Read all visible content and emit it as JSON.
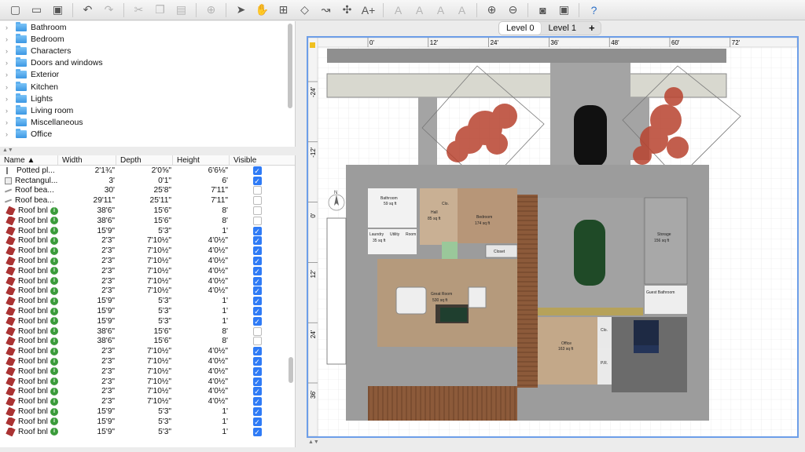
{
  "toolbar": {
    "buttons": [
      {
        "name": "new-home-button",
        "icon": "new-file-icon",
        "glyph": "▢"
      },
      {
        "name": "open-button",
        "icon": "folder-icon",
        "glyph": "▭"
      },
      {
        "name": "save-button",
        "icon": "save-icon",
        "glyph": "▣"
      },
      {
        "sep": true
      },
      {
        "name": "undo-button",
        "icon": "undo-icon",
        "glyph": "↶"
      },
      {
        "name": "redo-button",
        "icon": "redo-icon",
        "glyph": "↷",
        "dim": true
      },
      {
        "sep": true
      },
      {
        "name": "cut-button",
        "icon": "scissors-icon",
        "glyph": "✂",
        "dim": true
      },
      {
        "name": "copy-button",
        "icon": "copy-icon",
        "glyph": "❐",
        "dim": true
      },
      {
        "name": "paste-button",
        "icon": "paste-icon",
        "glyph": "▤",
        "dim": true
      },
      {
        "sep": true
      },
      {
        "name": "add-furniture-button",
        "icon": "add-furniture-icon",
        "glyph": "⊕",
        "dim": true
      },
      {
        "sep": true
      },
      {
        "name": "select-mode-button",
        "icon": "cursor-icon",
        "glyph": "➤"
      },
      {
        "name": "pan-mode-button",
        "icon": "hand-icon",
        "glyph": "✋"
      },
      {
        "name": "create-walls-button",
        "icon": "wall-icon",
        "glyph": "⊞"
      },
      {
        "name": "create-rooms-button",
        "icon": "room-icon",
        "glyph": "◇"
      },
      {
        "name": "create-polylines-button",
        "icon": "polyline-icon",
        "glyph": "↝"
      },
      {
        "name": "create-dimensions-button",
        "icon": "dimension-icon",
        "glyph": "✣"
      },
      {
        "name": "add-text-button",
        "icon": "text-icon",
        "glyph": "A+"
      },
      {
        "sep": true
      },
      {
        "name": "text-style-1-button",
        "icon": "text-style-icon",
        "glyph": "A",
        "dim": true
      },
      {
        "name": "text-style-2-button",
        "icon": "text-style-icon",
        "glyph": "A",
        "dim": true
      },
      {
        "name": "bold-button",
        "icon": "bold-icon",
        "glyph": "A",
        "dim": true
      },
      {
        "name": "italic-button",
        "icon": "italic-icon",
        "glyph": "A",
        "dim": true
      },
      {
        "sep": true
      },
      {
        "name": "zoom-in-button",
        "icon": "zoom-in-icon",
        "glyph": "⊕"
      },
      {
        "name": "zoom-out-button",
        "icon": "zoom-out-icon",
        "glyph": "⊖"
      },
      {
        "sep": true
      },
      {
        "name": "create-photo-button",
        "icon": "camera-icon",
        "glyph": "◙"
      },
      {
        "name": "create-video-button",
        "icon": "video-icon",
        "glyph": "▣"
      },
      {
        "sep": true
      },
      {
        "name": "help-button",
        "icon": "help-icon",
        "glyph": "?",
        "blue": true
      }
    ]
  },
  "catalog": {
    "categories": [
      "Bathroom",
      "Bedroom",
      "Characters",
      "Doors and windows",
      "Exterior",
      "Kitchen",
      "Lights",
      "Living room",
      "Miscellaneous",
      "Office"
    ]
  },
  "furniture_table": {
    "columns": {
      "name": "Name ▲",
      "width": "Width",
      "depth": "Depth",
      "height": "Height",
      "visible": "Visible"
    },
    "rows": [
      {
        "name": "Potted pl...",
        "w": "2'1¾\"",
        "d": "2'0⅝\"",
        "h": "6'6⅛\"",
        "v": true,
        "icon": "pot"
      },
      {
        "name": "Rectangul...",
        "w": "3'",
        "d": "0'1\"",
        "h": "6'",
        "v": true,
        "icon": "rect"
      },
      {
        "name": "Roof bea...",
        "w": "30'",
        "d": "25'8\"",
        "h": "7'11\"",
        "v": false,
        "icon": "beam"
      },
      {
        "name": "Roof bea...",
        "w": "29'11\"",
        "d": "25'11\"",
        "h": "7'11\"",
        "v": false,
        "icon": "beam"
      },
      {
        "name": "Roof bnl",
        "w": "38'6\"",
        "d": "15'6\"",
        "h": "8'",
        "v": false,
        "icon": "bnl"
      },
      {
        "name": "Roof bnl",
        "w": "38'6\"",
        "d": "15'6\"",
        "h": "8'",
        "v": false,
        "icon": "bnl"
      },
      {
        "name": "Roof bnl",
        "w": "15'9\"",
        "d": "5'3\"",
        "h": "1'",
        "v": true,
        "icon": "bnl"
      },
      {
        "name": "Roof bnl",
        "w": "2'3\"",
        "d": "7'10½\"",
        "h": "4'0½\"",
        "v": true,
        "icon": "bnl"
      },
      {
        "name": "Roof bnl",
        "w": "2'3\"",
        "d": "7'10½\"",
        "h": "4'0½\"",
        "v": true,
        "icon": "bnl"
      },
      {
        "name": "Roof bnl",
        "w": "2'3\"",
        "d": "7'10½\"",
        "h": "4'0½\"",
        "v": true,
        "icon": "bnl"
      },
      {
        "name": "Roof bnl",
        "w": "2'3\"",
        "d": "7'10½\"",
        "h": "4'0½\"",
        "v": true,
        "icon": "bnl"
      },
      {
        "name": "Roof bnl",
        "w": "2'3\"",
        "d": "7'10½\"",
        "h": "4'0½\"",
        "v": true,
        "icon": "bnl"
      },
      {
        "name": "Roof bnl",
        "w": "2'3\"",
        "d": "7'10½\"",
        "h": "4'0½\"",
        "v": true,
        "icon": "bnl"
      },
      {
        "name": "Roof bnl",
        "w": "15'9\"",
        "d": "5'3\"",
        "h": "1'",
        "v": true,
        "icon": "bnl"
      },
      {
        "name": "Roof bnl",
        "w": "15'9\"",
        "d": "5'3\"",
        "h": "1'",
        "v": true,
        "icon": "bnl"
      },
      {
        "name": "Roof bnl",
        "w": "15'9\"",
        "d": "5'3\"",
        "h": "1'",
        "v": true,
        "icon": "bnl"
      },
      {
        "name": "Roof bnl",
        "w": "38'6\"",
        "d": "15'6\"",
        "h": "8'",
        "v": false,
        "icon": "bnl"
      },
      {
        "name": "Roof bnl",
        "w": "38'6\"",
        "d": "15'6\"",
        "h": "8'",
        "v": false,
        "icon": "bnl"
      },
      {
        "name": "Roof bnl",
        "w": "2'3\"",
        "d": "7'10½\"",
        "h": "4'0½\"",
        "v": true,
        "icon": "bnl"
      },
      {
        "name": "Roof bnl",
        "w": "2'3\"",
        "d": "7'10½\"",
        "h": "4'0½\"",
        "v": true,
        "icon": "bnl"
      },
      {
        "name": "Roof bnl",
        "w": "2'3\"",
        "d": "7'10½\"",
        "h": "4'0½\"",
        "v": true,
        "icon": "bnl"
      },
      {
        "name": "Roof bnl",
        "w": "2'3\"",
        "d": "7'10½\"",
        "h": "4'0½\"",
        "v": true,
        "icon": "bnl"
      },
      {
        "name": "Roof bnl",
        "w": "2'3\"",
        "d": "7'10½\"",
        "h": "4'0½\"",
        "v": true,
        "icon": "bnl"
      },
      {
        "name": "Roof bnl",
        "w": "2'3\"",
        "d": "7'10½\"",
        "h": "4'0½\"",
        "v": true,
        "icon": "bnl"
      },
      {
        "name": "Roof bnl",
        "w": "15'9\"",
        "d": "5'3\"",
        "h": "1'",
        "v": true,
        "icon": "bnl"
      },
      {
        "name": "Roof bnl",
        "w": "15'9\"",
        "d": "5'3\"",
        "h": "1'",
        "v": true,
        "icon": "bnl"
      },
      {
        "name": "Roof bnl",
        "w": "15'9\"",
        "d": "5'3\"",
        "h": "1'",
        "v": true,
        "icon": "bnl"
      }
    ]
  },
  "levels": {
    "tabs": [
      "Level 0",
      "Level 1"
    ],
    "active": 0,
    "add": "+"
  },
  "plan": {
    "ruler_x": [
      "0'",
      "12'",
      "24'",
      "36'",
      "48'",
      "60'",
      "72'"
    ],
    "ruler_y": [
      "-24'",
      "-12'",
      "0'",
      "12'",
      "24'",
      "36'"
    ],
    "compass": "N",
    "rooms": {
      "bathroom": "Bathroom",
      "hall": "Hall",
      "closet_small": "Clo.",
      "bedroom": "Bedroom",
      "laundry": "Laundry",
      "utility": "Utility",
      "room": "Room",
      "closet": "Closet",
      "great_room": "Great Room",
      "storage": "Storage",
      "guest_bathroom": "Guest Bathroom",
      "office": "Office",
      "office_clo": "Clo.",
      "pr": "P.R."
    },
    "areas": {
      "bathroom": "59 sq ft",
      "hall": "85 sq ft",
      "bedroom": "174 sq ft",
      "laundry": "35 sq ft",
      "great_room": "530 sq ft",
      "storage": "156 sq ft",
      "office": "163 sq ft"
    },
    "colors": {
      "grid": "#dcdcdc",
      "wall": "#8a8a8a",
      "pavement": "#a8a8a8",
      "wood": "#9a6a48",
      "floor": "#c9a98a",
      "tree": "#b8432f",
      "selection": "#6d9ee8"
    }
  }
}
